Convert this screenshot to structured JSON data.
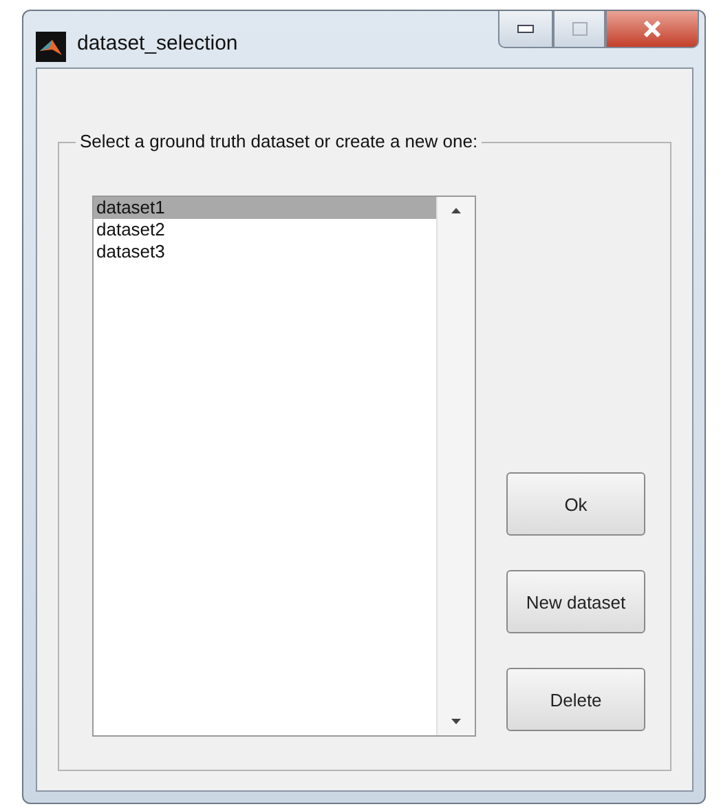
{
  "window": {
    "title": "dataset_selection"
  },
  "group": {
    "label": "Select a ground truth dataset or create a new one:"
  },
  "list": {
    "items": [
      {
        "label": "dataset1",
        "selected": true
      },
      {
        "label": "dataset2",
        "selected": false
      },
      {
        "label": "dataset3",
        "selected": false
      }
    ]
  },
  "buttons": [
    "Ok",
    "New dataset",
    "Delete"
  ]
}
